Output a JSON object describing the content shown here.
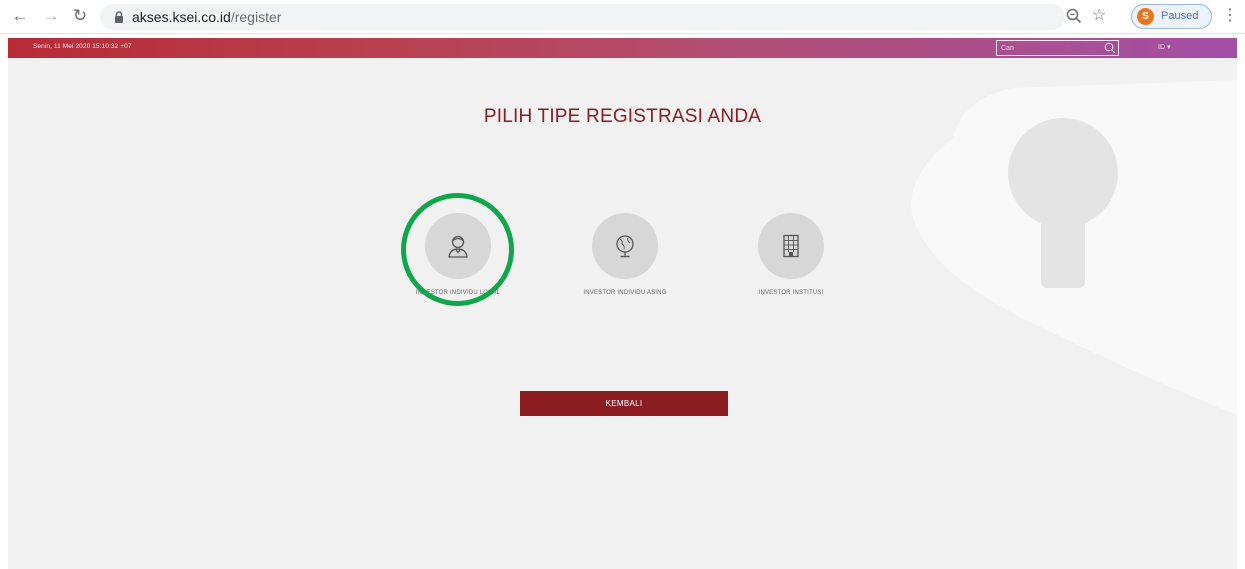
{
  "browser": {
    "url_host": "akses.ksei.co.id",
    "url_path": "/register",
    "profile_initial": "S",
    "profile_label": "Paused"
  },
  "topbar": {
    "datetime": "Senin, 11 Mei 2020 15:10:32 +07",
    "search_placeholder": "Cari",
    "language": "ID ▾"
  },
  "main": {
    "title": "PILIH TIPE REGISTRASI ANDA",
    "options": [
      {
        "label": "INVESTOR INDIVIDU LOKAL",
        "icon": "user-icon"
      },
      {
        "label": "INVESTOR INDIVIDU ASING",
        "icon": "globe-icon"
      },
      {
        "label": "INVESTOR INSTITUSI",
        "icon": "building-icon"
      }
    ],
    "back_label": "KEMBALI"
  },
  "colors": {
    "accent": "#8a1c22",
    "highlight": "#10a64a",
    "topbar_start": "#b72b37",
    "topbar_end": "#a24fa5"
  }
}
